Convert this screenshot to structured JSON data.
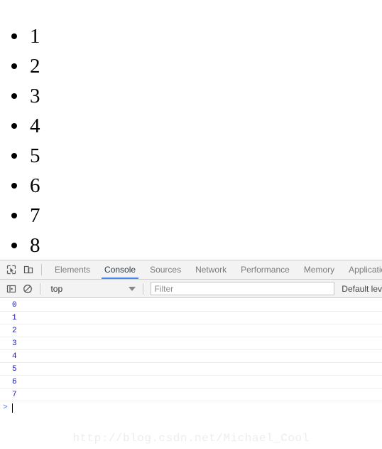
{
  "page": {
    "list_items": [
      "1",
      "2",
      "3",
      "4",
      "5",
      "6",
      "7",
      "8"
    ]
  },
  "devtools": {
    "toolbar_icons": [
      {
        "name": "inspect-element-icon",
        "title": "Inspect element"
      },
      {
        "name": "device-toolbar-icon",
        "title": "Toggle device toolbar"
      }
    ],
    "tabs": [
      {
        "label": "Elements",
        "active": false
      },
      {
        "label": "Console",
        "active": true
      },
      {
        "label": "Sources",
        "active": false
      },
      {
        "label": "Network",
        "active": false
      },
      {
        "label": "Performance",
        "active": false
      },
      {
        "label": "Memory",
        "active": false
      },
      {
        "label": "Application",
        "active": false
      }
    ],
    "active_tab": "Console",
    "accent_color": "#4285f4",
    "filterbar": {
      "sidebar_toggle_icon": "console-sidebar-icon",
      "clear_console_icon": "clear-console-icon",
      "context": "top",
      "filter_value": "",
      "filter_placeholder": "Filter",
      "level": "Default lev"
    },
    "console": {
      "messages": [
        "0",
        "1",
        "2",
        "3",
        "4",
        "5",
        "6",
        "7"
      ],
      "message_color": "#1a1aa6",
      "prompt_symbol": ">",
      "prompt_value": ""
    }
  },
  "watermark": {
    "text": "http://blog.csdn.net/Michael_Cool"
  }
}
